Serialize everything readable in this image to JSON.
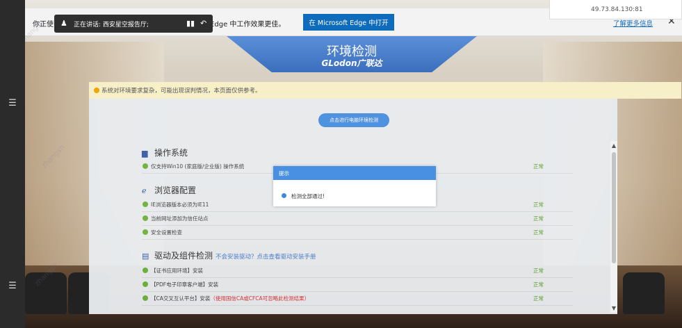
{
  "left_strip": {
    "top_glyph": "☰",
    "bottom_glyph": "☰"
  },
  "edge_infobar": {
    "text_left": "你正使",
    "text_right": "icrosoft Edge 中工作效果更佳。",
    "open_button": "在 Microsoft Edge 中打开",
    "learn_more": "了解更多信息",
    "close": "✕"
  },
  "meeting_pill": {
    "text": "正在讲话: 西安星空报告厅;"
  },
  "ip_overlay": {
    "ip": "49.73.84.130:81"
  },
  "banner": {
    "title": "环境检测",
    "brand": "GLodon广联达"
  },
  "notice": {
    "text": "系统对环境要求复杂，可能出现误判情况，本页面仅供参考。"
  },
  "check_button": "点击进行电脑环境检测",
  "sections": {
    "os": {
      "title": "操作系统",
      "rows": [
        {
          "label": "仅支持Win10 (家庭版/企业版) 操作系统",
          "status": "正常"
        }
      ]
    },
    "browser": {
      "title": "浏览器配置",
      "rows": [
        {
          "label": "IE浏览器版本必须为IE11",
          "status": "正常"
        },
        {
          "label": "当前网址添加为信任站点",
          "status": "正常"
        },
        {
          "label": "安全设置检查",
          "status": "正常"
        }
      ]
    },
    "drivers": {
      "title": "驱动及组件检测",
      "link": "不会安装驱动？点击查看驱动安装手册",
      "rows": [
        {
          "label": "【证书应用环境】安装",
          "status": "正常"
        },
        {
          "label": "【PDF电子印章客户端】安装",
          "status": "正常"
        },
        {
          "label": "【CA交叉互认平台】安装",
          "note": "（使用国信CA或CFCA可忽略此检测结果）",
          "status": "正常"
        }
      ]
    }
  },
  "dialog": {
    "title": "提示",
    "message": "检测全部通过!"
  },
  "colors": {
    "accent": "#4a90e2",
    "ok": "#6fb33c",
    "edge_blue": "#0f6cbd"
  }
}
